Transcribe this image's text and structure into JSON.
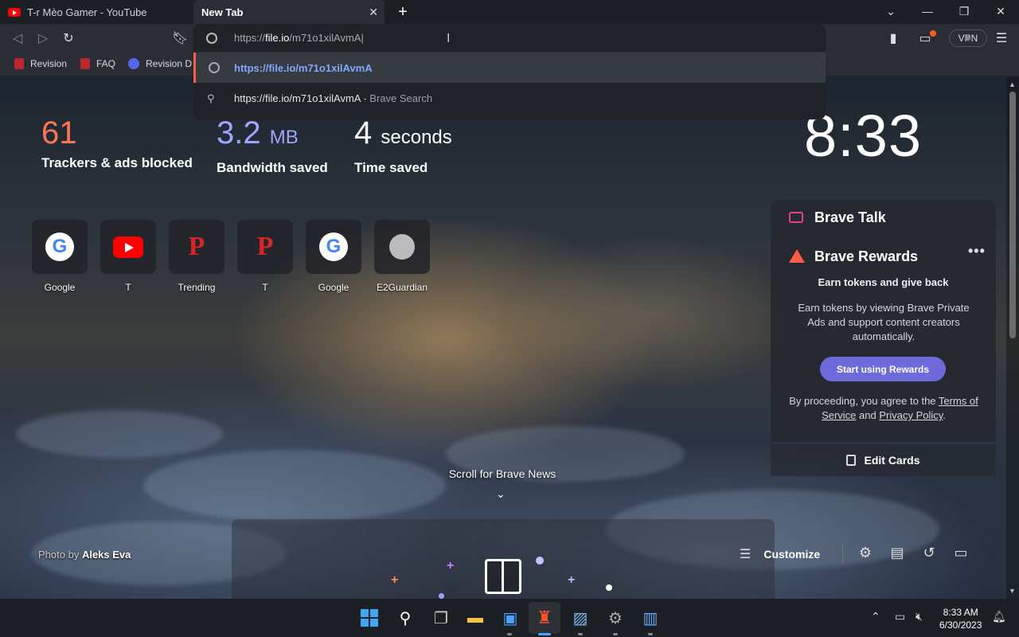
{
  "tabs": [
    {
      "title": "T-r Mèo Gamer - YouTube",
      "active": false
    },
    {
      "title": "New Tab",
      "active": true
    }
  ],
  "omnibox": {
    "prefix": "https://",
    "host": "file.io",
    "path": "/m71o1xilAvmA"
  },
  "suggestions": [
    {
      "text": "https://file.io/m71o1xilAvmA",
      "subtitle": "",
      "icon": "globe-icon"
    },
    {
      "text": "https://file.io/m71o1xilAvmA",
      "subtitle": " - Brave Search",
      "icon": "search-icon"
    }
  ],
  "vpn_label": "VPN",
  "bookmarks": [
    {
      "label": "Revision",
      "icon": "revision-icon"
    },
    {
      "label": "FAQ",
      "icon": "revision-icon"
    },
    {
      "label": "Revision Di",
      "icon": "discord-icon"
    }
  ],
  "stats": {
    "trackers": {
      "value": "61",
      "label": "Trackers & ads blocked"
    },
    "bandwidth": {
      "value": "3.2",
      "unit": "MB",
      "label": "Bandwidth saved"
    },
    "time": {
      "value": "4",
      "unit": "seconds",
      "label": "Time saved"
    }
  },
  "clock": "8:33",
  "top_sites": [
    {
      "name": "Google",
      "icon": "google-icon"
    },
    {
      "name": "T",
      "icon": "youtube-icon"
    },
    {
      "name": "Trending",
      "icon": "revision-p-icon"
    },
    {
      "name": "T",
      "icon": "revision-p-icon"
    },
    {
      "name": "Google",
      "icon": "google-icon"
    },
    {
      "name": "E2Guardian",
      "icon": "globe-icon"
    }
  ],
  "brave_talk": {
    "title": "Brave Talk"
  },
  "brave_rewards": {
    "title": "Brave Rewards",
    "more": "•••",
    "headline": "Earn tokens and give back",
    "body": "Earn tokens by viewing Brave Private Ads and support content creators automatically.",
    "button": "Start using Rewards",
    "legal_prefix": "By proceeding, you agree to the ",
    "terms": "Terms of Service",
    "and": " and ",
    "privacy": "Privacy Policy",
    "legal_suffix": "."
  },
  "edit_cards": "Edit Cards",
  "scroll_news": "Scroll for Brave News",
  "photo_credit": {
    "prefix": "Photo by ",
    "author": "Aleks Eva"
  },
  "customize": "Customize",
  "taskbar": {
    "time": "8:33 AM",
    "date": "6/30/2023"
  },
  "colors": {
    "accent_red": "#ff7654",
    "accent_blue": "#a0a5ff",
    "rewards_button": "#6d6bd9",
    "brave_talk": "#e6467f"
  }
}
